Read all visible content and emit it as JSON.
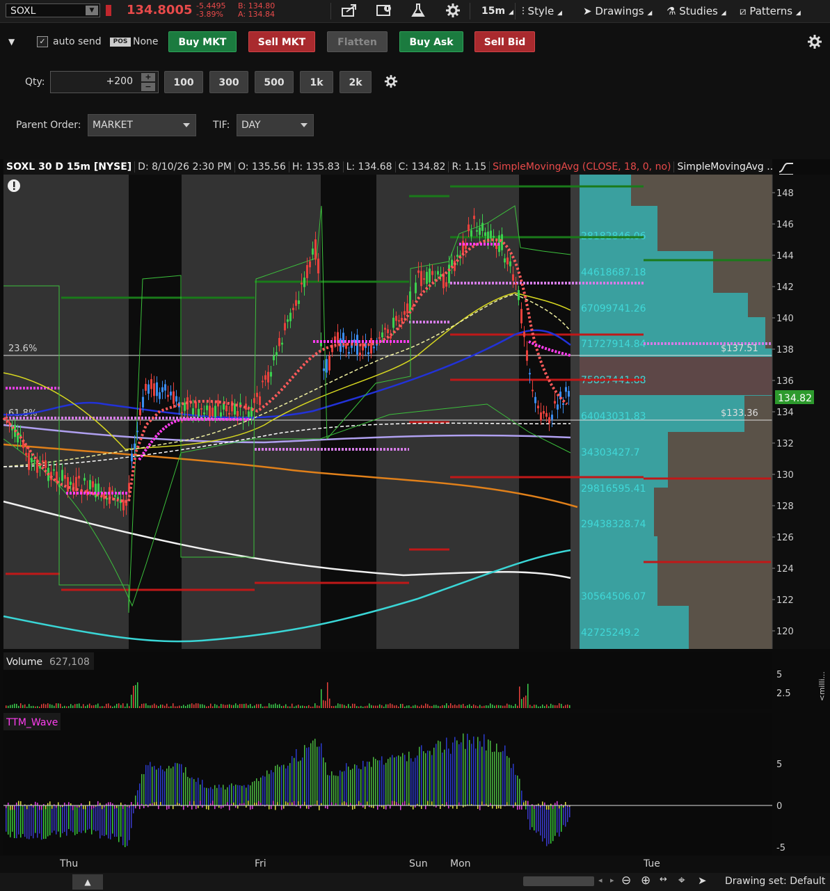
{
  "toolbar": {
    "symbol": "SOXL",
    "last_price": "134.8005",
    "change_abs": "-5.4495",
    "change_pct": "-3.89%",
    "bid": "B: 134.80",
    "ask": "A: 134.84",
    "timeframe": "15m",
    "style_label": "Style",
    "drawings_label": "Drawings",
    "studies_label": "Studies",
    "patterns_label": "Patterns"
  },
  "order": {
    "auto_send_label": "auto send",
    "auto_send_checked": true,
    "pos_badge": "POS",
    "pos_value": "None",
    "buy_mkt": "Buy MKT",
    "sell_mkt": "Sell MKT",
    "flatten": "Flatten",
    "buy_ask": "Buy Ask",
    "sell_bid": "Sell Bid",
    "qty_label": "Qty:",
    "qty_value": "+200",
    "qty_presets": [
      "100",
      "300",
      "500",
      "1k",
      "2k"
    ],
    "parent_order_label": "Parent Order:",
    "parent_order_value": "MARKET",
    "tif_label": "TIF:",
    "tif_value": "DAY"
  },
  "chart": {
    "header": {
      "title": "SOXL 30 D 15m [NYSE]",
      "date": "D: 8/10/26 2:30 PM",
      "open": "O: 135.56",
      "high": "H: 135.83",
      "low": "L: 134.68",
      "close": "C: 134.82",
      "range": "R: 1.15",
      "study1": "SimpleMovingAvg (CLOSE, 18, 0, no)",
      "study2": "SimpleMovingAvg ..."
    },
    "price_axis": [
      "148",
      "146",
      "144",
      "142",
      "140",
      "138",
      "136",
      "134",
      "132",
      "130",
      "128",
      "126",
      "124",
      "122",
      "120"
    ],
    "fib_labels": [
      "23.6%",
      "61.8%"
    ],
    "price_tags": {
      "upper": "$137.51",
      "lower": "$133.36",
      "current": "134.82"
    },
    "volume_profile_labels": [
      "28182846.06",
      "44618687.18",
      "67099741.26",
      "71727914.84",
      "75897441.88",
      "64043031.83",
      "34303427.7",
      "29816595.41",
      "29438328.74",
      "30564506.07",
      "42725249.2"
    ],
    "time_labels": [
      "Thu",
      "Fri",
      "Sun",
      "Mon",
      "Tue"
    ]
  },
  "volume": {
    "label": "Volume",
    "value": "627,108",
    "axis": [
      "5",
      "2.5"
    ],
    "unit": "<milli..."
  },
  "ttm": {
    "label": "TTM_Wave",
    "axis": [
      "5",
      "0",
      "-5"
    ]
  },
  "bottom": {
    "drawing_set": "Drawing set: Default"
  },
  "colors": {
    "up": "#3ccf4e",
    "down": "#e8413c",
    "cyan": "#3fd6d6",
    "magenta": "#ff3df0",
    "accent_red": "#c0272d"
  }
}
